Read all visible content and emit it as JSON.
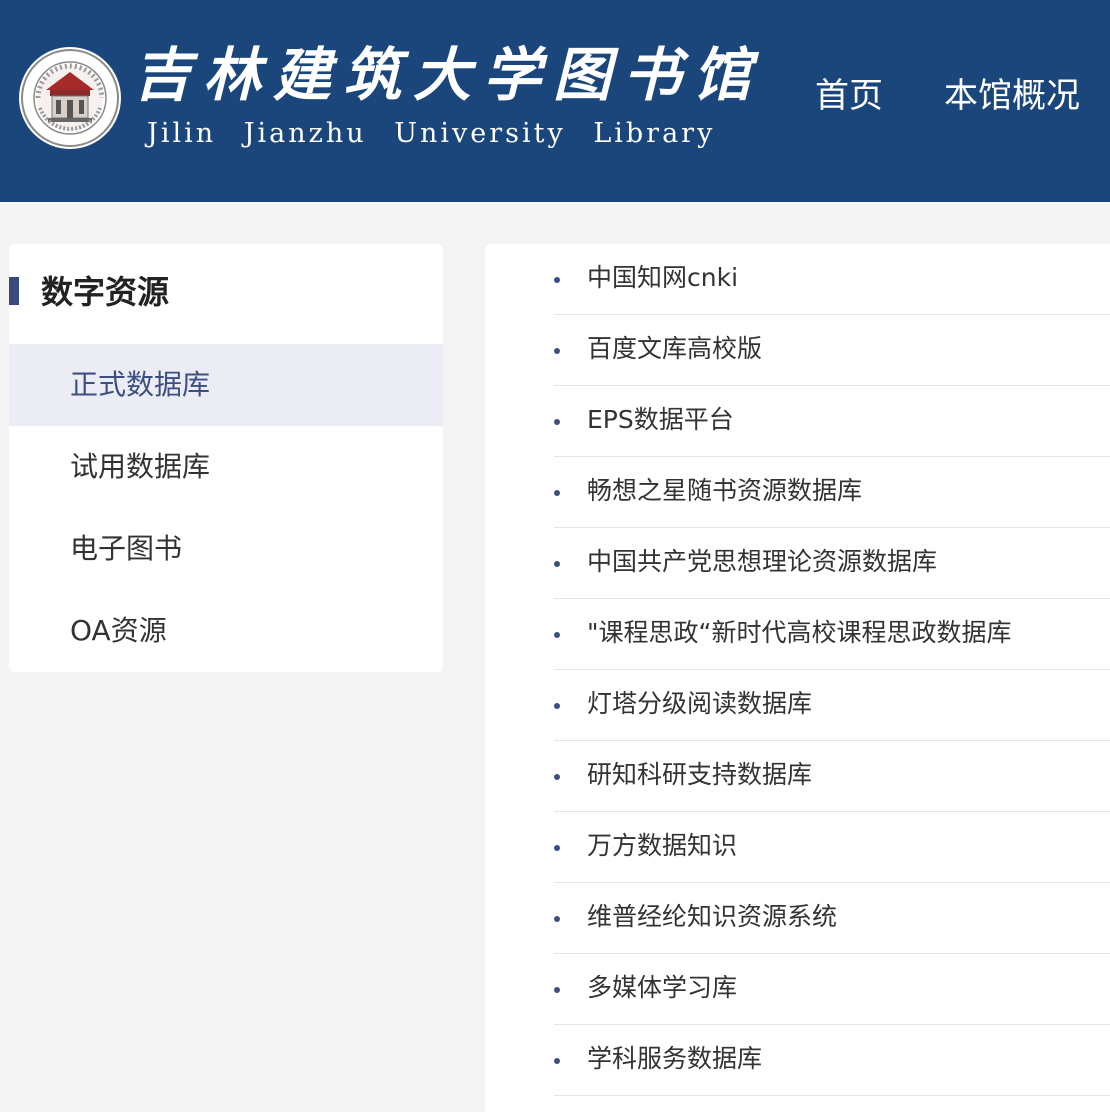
{
  "header": {
    "logo_cn": "吉林建筑大学图书馆",
    "logo_en": "Jilin Jianzhu University Library",
    "nav": [
      {
        "label": "首页"
      },
      {
        "label": "本馆概况"
      }
    ],
    "colors": {
      "header_bg": "#1b467c",
      "accent": "#3d4f82"
    }
  },
  "sidebar": {
    "title": "数字资源",
    "items": [
      {
        "label": "正式数据库",
        "active": true
      },
      {
        "label": "试用数据库",
        "active": false
      },
      {
        "label": "电子图书",
        "active": false
      },
      {
        "label": "OA资源",
        "active": false
      }
    ]
  },
  "databases": [
    {
      "label": "中国知网cnki"
    },
    {
      "label": "百度文库高校版"
    },
    {
      "label": "EPS数据平台"
    },
    {
      "label": "畅想之星随书资源数据库"
    },
    {
      "label": "中国共产党思想理论资源数据库"
    },
    {
      "label": "\"课程思政“新时代高校课程思政数据库"
    },
    {
      "label": "灯塔分级阅读数据库"
    },
    {
      "label": "研知科研支持数据库"
    },
    {
      "label": "万方数据知识"
    },
    {
      "label": "维普经纶知识资源系统"
    },
    {
      "label": "多媒体学习库"
    },
    {
      "label": "学科服务数据库"
    }
  ]
}
